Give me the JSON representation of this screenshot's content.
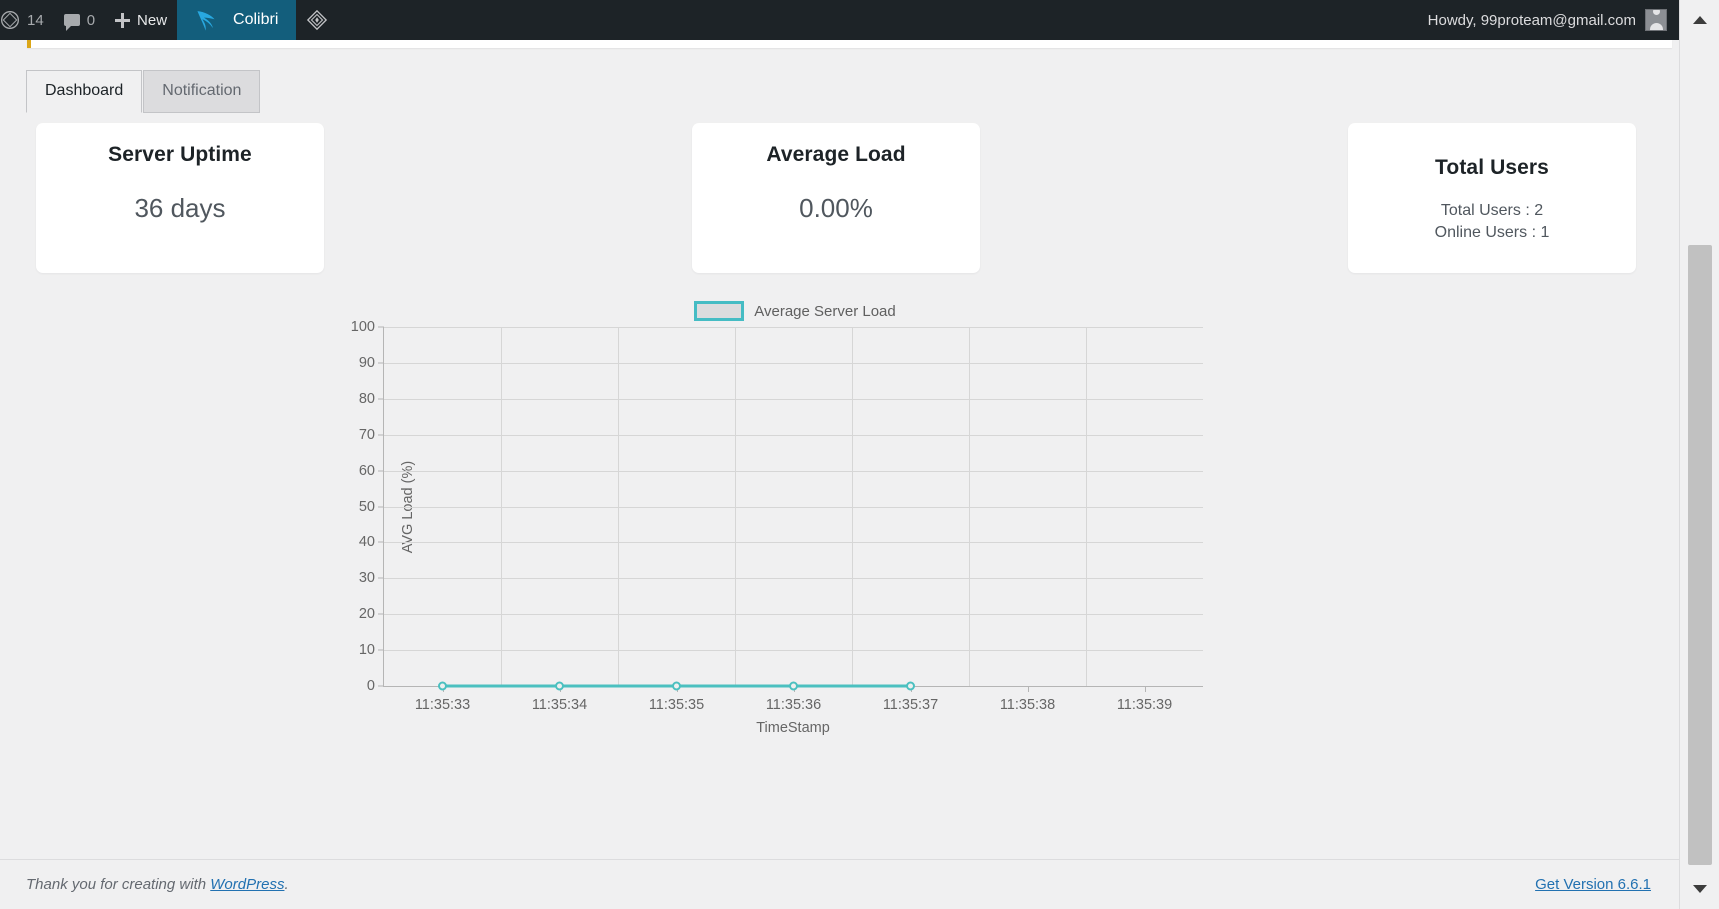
{
  "adminbar": {
    "wp_logo_icon": "wordpress-logo-icon",
    "updates_count": "14",
    "comments_icon": "comment-bubble-icon",
    "comments_count": "0",
    "new_icon": "plus-icon",
    "new_label": "New",
    "colibri_icon": "colibri-hummingbird-icon",
    "colibri_label": "Colibri",
    "extra_icon": "diamond-plugin-icon",
    "howdy": "Howdy, 99proteam@gmail.com",
    "avatar_icon": "user-avatar-icon"
  },
  "tabs": [
    {
      "label": "Dashboard",
      "active": true
    },
    {
      "label": "Notification",
      "active": false
    }
  ],
  "cards": [
    {
      "title": "Server Uptime",
      "value": "36 days"
    },
    {
      "title": "Average Load",
      "value": "0.00%"
    }
  ],
  "users_card": {
    "title": "Total Users",
    "total_line": "Total Users : 2",
    "online_line": "Online Users : 1"
  },
  "chart_data": {
    "type": "line",
    "title": "",
    "legend": [
      "Average Server Load"
    ],
    "legend_position": "top-center",
    "legend_swatch_color": "#45bcc4",
    "line_color": "#4bc0c0",
    "xlabel": "TimeStamp",
    "ylabel": "AVG Load (%)",
    "x": [
      "11:35:33",
      "11:35:34",
      "11:35:35",
      "11:35:36",
      "11:35:37",
      "11:35:38",
      "11:35:39"
    ],
    "xticks": [
      "11:35:33",
      "11:35:34",
      "11:35:35",
      "11:35:36",
      "11:35:37",
      "11:35:38",
      "11:35:39"
    ],
    "yticks": [
      0,
      10,
      20,
      30,
      40,
      50,
      60,
      70,
      80,
      90,
      100
    ],
    "ylim": [
      0,
      100
    ],
    "grid": true,
    "series": [
      {
        "name": "Average Server Load",
        "x": [
          "11:35:33",
          "11:35:34",
          "11:35:35",
          "11:35:36",
          "11:35:37"
        ],
        "values": [
          0,
          0,
          0,
          0,
          0
        ]
      }
    ]
  },
  "footer": {
    "thanks_prefix": "Thank you for creating with ",
    "wordpress_link": "WordPress",
    "thanks_suffix": ".",
    "version_link": "Get Version 6.6.1"
  },
  "scrollbar": {
    "up_icon": "scroll-up-arrow-icon",
    "down_icon": "scroll-down-arrow-icon"
  }
}
